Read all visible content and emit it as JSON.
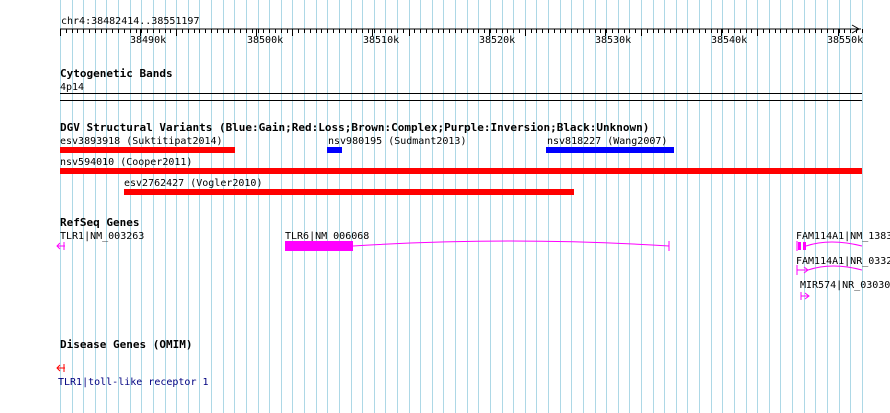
{
  "ruler": {
    "coordinates": "chr4:38482414..38551197",
    "ticks": [
      "38490k",
      "38500k",
      "38510k",
      "38520k",
      "38530k",
      "38540k",
      "38550k"
    ]
  },
  "cytoband": {
    "title": "Cytogenetic Bands",
    "band": "4p14"
  },
  "dgv": {
    "title": "DGV Structural Variants (Blue:Gain;Red:Loss;Brown:Complex;Purple:Inversion;Black:Unknown)",
    "variants": [
      {
        "label": "esv3893918 (Suktitipat2014)",
        "type": "Loss",
        "color": "#ff0000"
      },
      {
        "label": "nsv980195 (Sudmant2013)",
        "type": "Gain",
        "color": "#0000ff"
      },
      {
        "label": "nsv818227 (Wang2007)",
        "type": "Gain",
        "color": "#0000ff"
      },
      {
        "label": "nsv594010 (Cooper2011)",
        "type": "Loss",
        "color": "#ff0000"
      },
      {
        "label": "esv2762427 (Vogler2010)",
        "type": "Loss",
        "color": "#ff0000"
      }
    ]
  },
  "refseq": {
    "title": "RefSeq Genes",
    "genes": [
      {
        "label": "TLR1|NM_003263"
      },
      {
        "label": "TLR6|NM_006068"
      },
      {
        "label": "FAM114A1|NM_1383"
      },
      {
        "label": "FAM114A1|NR_0332"
      },
      {
        "label": "MIR574|NR_03030"
      }
    ],
    "color": "#ff00ff"
  },
  "omim": {
    "title": "Disease Genes (OMIM)",
    "genes": [
      {
        "label": "TLR1|toll-like receptor 1"
      }
    ],
    "label_color": "#000080",
    "glyph_color": "#ff0000"
  },
  "colors": {
    "grid": "#add8e6",
    "loss": "#ff0000",
    "gain": "#0000ff",
    "gene": "#ff00ff"
  }
}
